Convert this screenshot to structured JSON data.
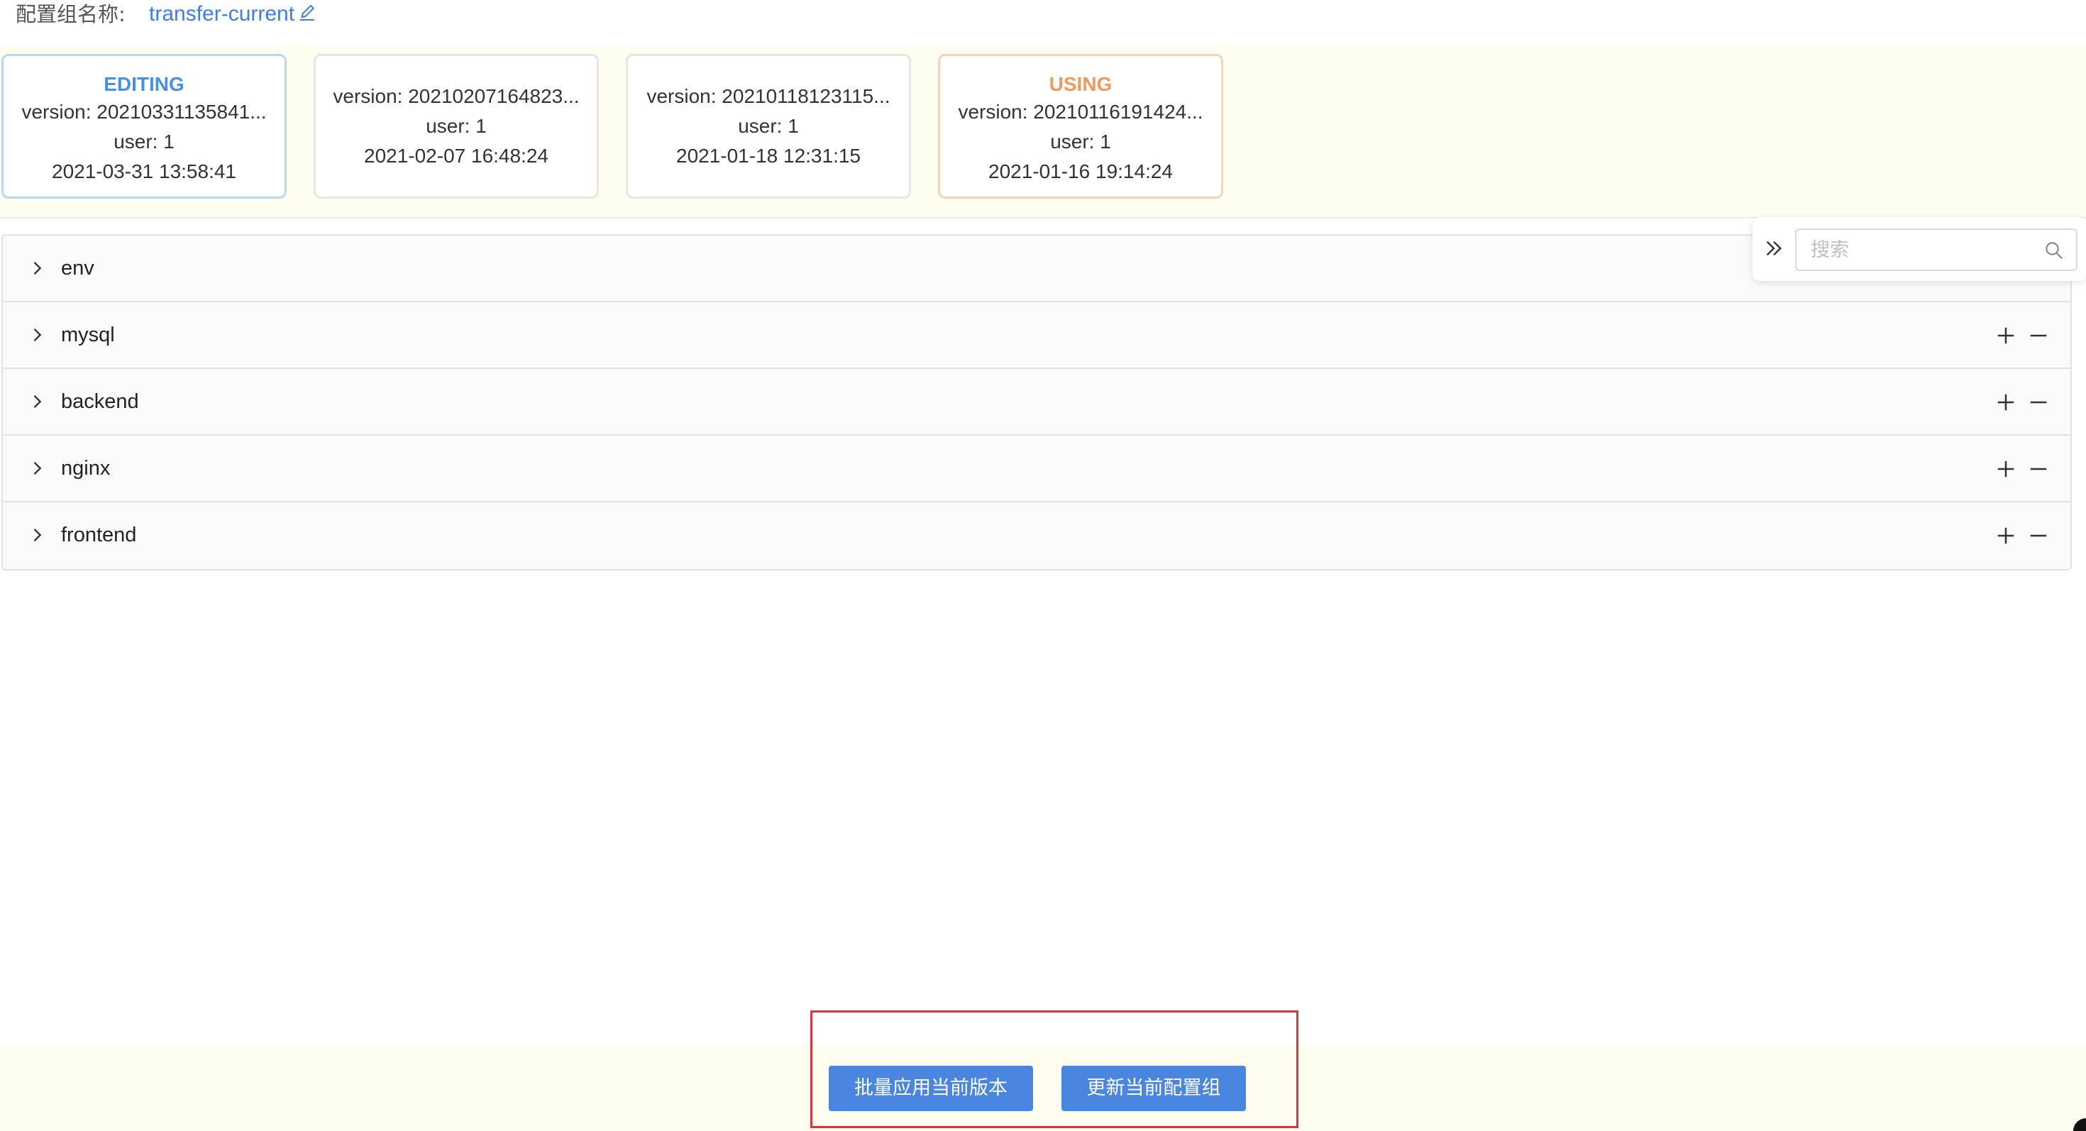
{
  "header": {
    "label": "配置组名称:",
    "group_name": "transfer-current",
    "edit_icon": "edit-pencil-icon"
  },
  "versions": [
    {
      "status": "EDITING",
      "version": "version: 20210331135841...",
      "user": "user: 1",
      "time": "2021-03-31 13:58:41"
    },
    {
      "status": "",
      "version": "version: 20210207164823...",
      "user": "user: 1",
      "time": "2021-02-07 16:48:24"
    },
    {
      "status": "",
      "version": "version: 20210118123115...",
      "user": "user: 1",
      "time": "2021-01-18 12:31:15"
    },
    {
      "status": "USING",
      "version": "version: 20210116191424...",
      "user": "user: 1",
      "time": "2021-01-16 19:14:24"
    }
  ],
  "search": {
    "placeholder": "搜索",
    "value": ""
  },
  "panels": [
    {
      "name": "env",
      "has_actions": false
    },
    {
      "name": "mysql",
      "has_actions": true
    },
    {
      "name": "backend",
      "has_actions": true
    },
    {
      "name": "nginx",
      "has_actions": true
    },
    {
      "name": "frontend",
      "has_actions": true
    }
  ],
  "footer": {
    "batch_apply_label": "批量应用当前版本",
    "update_group_label": "更新当前配置组"
  },
  "colors": {
    "accent": "#3a7ee6",
    "button": "#4a86e0",
    "editing": "#4a90e2",
    "using": "#ee9a5d",
    "highlight_border": "#d9363e",
    "strip_bg": "#fffdf0"
  }
}
